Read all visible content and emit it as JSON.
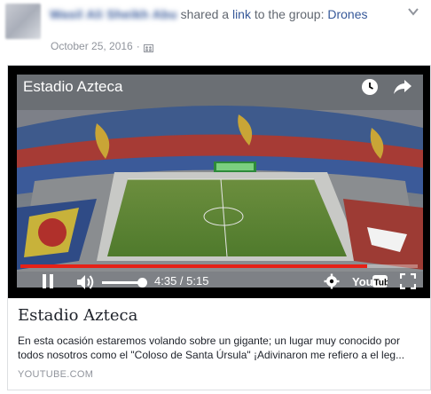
{
  "post": {
    "author_name": "Wasil Ali Sheikh Abu",
    "action_text": "shared a",
    "link_word": "link",
    "to_text": "to the group:",
    "group_name": "Drones",
    "date": "October 25, 2016",
    "separator": "·",
    "audience_icon": "group-audience-icon",
    "menu_icon": "chevron-down-icon"
  },
  "video": {
    "title": "Estadio Azteca",
    "watch_later_icon": "clock-icon",
    "share_icon": "share-arrow-icon",
    "current_time": "4:35",
    "duration": "5:15",
    "time_display": "4:35 / 5:15",
    "progress_fraction": 0.873,
    "volume_fraction": 0.9,
    "controls": {
      "play": "pause-icon",
      "volume": "volume-icon",
      "settings": "gear-icon",
      "logo": "youtube-logo",
      "fullscreen": "fullscreen-icon"
    },
    "colors": {
      "progress": "#e62117",
      "background": "#000000"
    }
  },
  "card": {
    "title": "Estadio Azteca",
    "description_line1": "En esta ocasión estaremos volando sobre un gigante; un lugar muy conocido por",
    "description_line2": "todos nosotros como el \"Coloso de Santa Úrsula\" ¡Adivinaron me refiero a el leg...",
    "domain": "YOUTUBE.COM"
  },
  "colors": {
    "link": "#365899",
    "muted": "#90949c",
    "text": "#1d2129"
  }
}
